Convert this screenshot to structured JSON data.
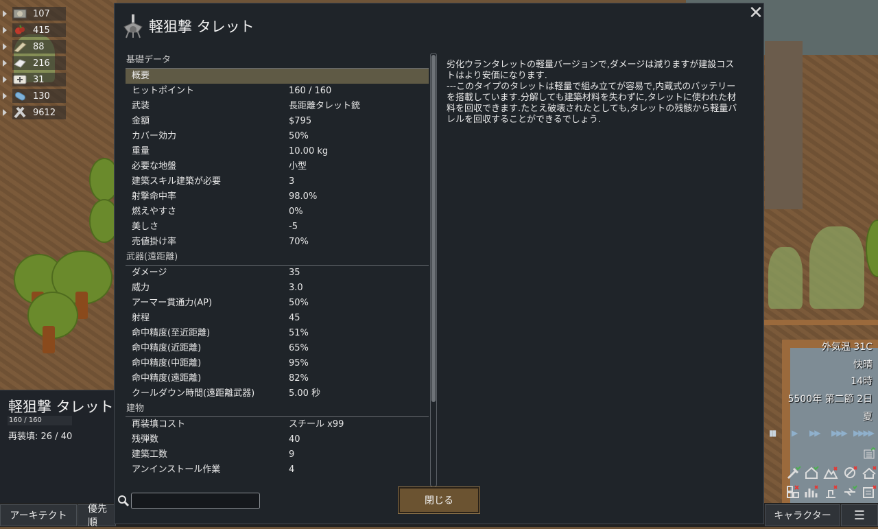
{
  "resources": [
    {
      "icon": "silver-icon",
      "value": "107"
    },
    {
      "icon": "berries-icon",
      "value": "415"
    },
    {
      "icon": "wood-icon",
      "value": "88"
    },
    {
      "icon": "cloth-icon",
      "value": "216"
    },
    {
      "icon": "medicine-icon",
      "value": "31"
    },
    {
      "icon": "meal-icon",
      "value": "130"
    },
    {
      "icon": "steel-icon",
      "value": "9612"
    }
  ],
  "inspect": {
    "title": "軽狙撃 タレット",
    "hp": "160 / 160",
    "reload": "再装填: 26 / 40"
  },
  "dialog": {
    "title": "軽狙撃 タレット",
    "close_symbol": "✕",
    "sections": [
      {
        "category": "基礎データ",
        "rows": [
          {
            "label": "概要",
            "value": "",
            "selected": true
          },
          {
            "label": "ヒットポイント",
            "value": "160 / 160"
          },
          {
            "label": "武装",
            "value": "長距離タレット銃"
          },
          {
            "label": "金額",
            "value": "$795"
          },
          {
            "label": "カバー効力",
            "value": "50%"
          },
          {
            "label": "重量",
            "value": "10.00 kg"
          },
          {
            "label": "必要な地盤",
            "value": "小型"
          },
          {
            "label": "建築スキル建築が必要",
            "value": "3"
          },
          {
            "label": "射撃命中率",
            "value": "98.0%"
          },
          {
            "label": "燃えやすさ",
            "value": "0%"
          },
          {
            "label": "美しさ",
            "value": "-5"
          },
          {
            "label": "売値掛け率",
            "value": "70%"
          }
        ]
      },
      {
        "category": "武器(遠距離)",
        "rows": [
          {
            "label": "ダメージ",
            "value": "35"
          },
          {
            "label": "威力",
            "value": "3.0"
          },
          {
            "label": "アーマー貫通力(AP)",
            "value": "50%"
          },
          {
            "label": "射程",
            "value": "45"
          },
          {
            "label": "命中精度(至近距離)",
            "value": "51%"
          },
          {
            "label": "命中精度(近距離)",
            "value": "65%"
          },
          {
            "label": "命中精度(中距離)",
            "value": "95%"
          },
          {
            "label": "命中精度(遠距離)",
            "value": "82%"
          },
          {
            "label": "クールダウン時間(遠距離武器)",
            "value": "5.00 秒"
          }
        ]
      },
      {
        "category": "建物",
        "rows": [
          {
            "label": "再装填コスト",
            "value": "スチール x99"
          },
          {
            "label": "残弾数",
            "value": "40"
          },
          {
            "label": "建築工数",
            "value": "9"
          },
          {
            "label": "アンインストール作業",
            "value": "4"
          }
        ]
      }
    ],
    "description_1": "劣化ウランタレットの軽量バージョンで,ダメージは減りますが建設コストはより安価になります.",
    "description_2": "---このタイプのタレットは軽量で組み立てが容易で,内蔵式のバッテリーを搭載しています.分解しても建築材料を失わずに,タレットに使われた材料を回収できます.たとえ破壊されたとしても,タレットの残骸から軽量バレルを回収することができるでしょう.",
    "search": {
      "value": "",
      "placeholder": ""
    },
    "close_button": "閉じる"
  },
  "hud": {
    "temperature": "外気温 31C",
    "weather": "快晴",
    "hour": "14時",
    "date": "5500年 第二節 2日",
    "season": "夏",
    "speed_pause": "▮▮",
    "speed_1": "▶",
    "speed_2": "▶▶",
    "speed_3": "▶▶▶",
    "speed_4": "▶▶▶▶"
  },
  "bottom_bar": {
    "architect": "アーキテクト",
    "priority": "優先順",
    "character": "キャラクター",
    "menu_icon": "☰"
  }
}
